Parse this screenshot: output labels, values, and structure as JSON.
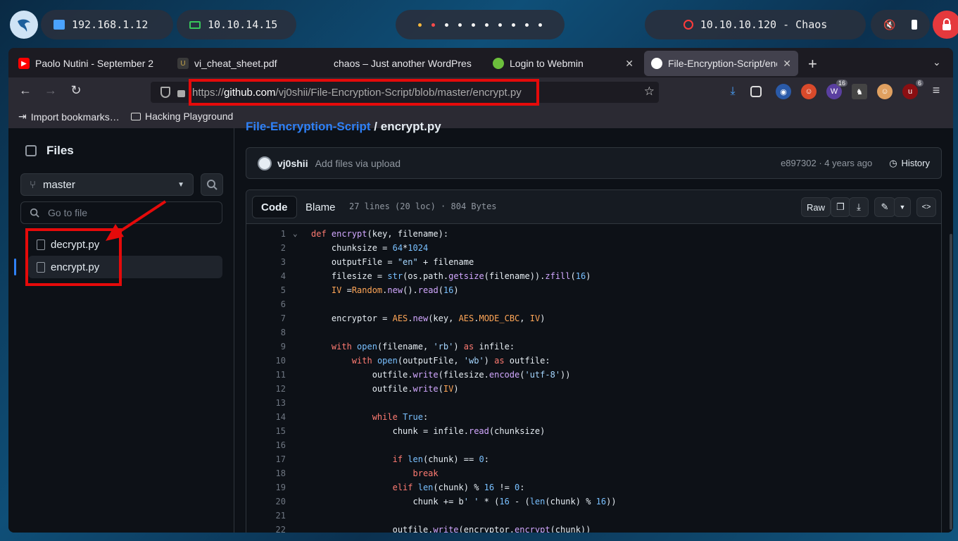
{
  "panel": {
    "ip_local": "192.168.1.12",
    "ip_vpn": "10.10.14.15",
    "target": "10.10.10.120 - Chaos",
    "workspace_dots": 10
  },
  "tabs": [
    {
      "title": "Paolo Nutini - September 2",
      "favicon": "youtube-icon",
      "color": "#ff0000",
      "active": false
    },
    {
      "title": "vi_cheat_sheet.pdf",
      "favicon": "pdf-icon",
      "color": "#c4a34a",
      "active": false
    },
    {
      "title": "chaos – Just another WordPres",
      "favicon": "none",
      "color": "",
      "active": false
    },
    {
      "title": "Login to Webmin",
      "favicon": "webmin-icon",
      "color": "#6cbf3c",
      "active": false
    },
    {
      "title": "File-Encryption-Script/encr",
      "favicon": "github-icon",
      "color": "#ffffff",
      "active": true
    }
  ],
  "urlbar": {
    "prefix": "https://",
    "host": "github.com",
    "path": "/vj0shii/File-Encryption-Script/blob/master/encrypt.py"
  },
  "extensions": [
    {
      "name": "download-icon"
    },
    {
      "name": "puzzle-icon"
    },
    {
      "name": "foxyproxy-icon"
    },
    {
      "name": "santa-icon"
    },
    {
      "name": "wappalyzer-icon",
      "badge": "16"
    },
    {
      "name": "cookie-editor-icon"
    },
    {
      "name": "hackbar-icon"
    },
    {
      "name": "ublock-icon",
      "badge": "6"
    }
  ],
  "bookmarks": [
    {
      "label": "Import bookmarks…",
      "icon": "import-icon"
    },
    {
      "label": "Hacking Playground",
      "icon": "folder-icon"
    }
  ],
  "sidebar": {
    "title": "Files",
    "branch": "master",
    "goto_placeholder": "Go to file",
    "files": [
      "decrypt.py",
      "encrypt.py"
    ],
    "selected": "encrypt.py"
  },
  "main": {
    "breadcrumb_repo": "File-Encryption-Script",
    "breadcrumb_file": "encrypt.py",
    "commit": {
      "author": "vj0shii",
      "message": "Add files via upload",
      "sha": "e897302",
      "age": "4 years ago",
      "history_label": "History"
    },
    "code_header": {
      "tab_code": "Code",
      "tab_blame": "Blame",
      "stats": "27 lines (20 loc) · 804 Bytes",
      "raw_label": "Raw"
    }
  },
  "code_lines": [
    {
      "n": "1",
      "html": "<span class='k'>def</span> <span class='f'>encrypt</span>(key, filename):"
    },
    {
      "n": "2",
      "html": "    chunksize = <span class='n'>64</span>*<span class='n'>1024</span>"
    },
    {
      "n": "3",
      "html": "    outputFile = <span class='s'>\"en\"</span> + filename"
    },
    {
      "n": "4",
      "html": "    filesize = <span class='n'>str</span>(os.path.<span class='f'>getsize</span>(filename)).<span class='f'>zfill</span>(<span class='n'>16</span>)"
    },
    {
      "n": "5",
      "html": "    <span class='c'>IV</span> =<span class='c'>Random</span>.<span class='f'>new</span>().<span class='f'>read</span>(<span class='n'>16</span>)"
    },
    {
      "n": "6",
      "html": ""
    },
    {
      "n": "7",
      "html": "    encryptor = <span class='c'>AES</span>.<span class='f'>new</span>(key, <span class='c'>AES</span>.<span class='c'>MODE_CBC</span>, <span class='c'>IV</span>)"
    },
    {
      "n": "8",
      "html": ""
    },
    {
      "n": "9",
      "html": "    <span class='k'>with</span> <span class='n'>open</span>(filename, <span class='s'>'rb'</span>) <span class='k'>as</span> infile:"
    },
    {
      "n": "10",
      "html": "        <span class='k'>with</span> <span class='n'>open</span>(outputFile, <span class='s'>'wb'</span>) <span class='k'>as</span> outfile:"
    },
    {
      "n": "11",
      "html": "            outfile.<span class='f'>write</span>(filesize.<span class='f'>encode</span>(<span class='s'>'utf-8'</span>))"
    },
    {
      "n": "12",
      "html": "            outfile.<span class='f'>write</span>(<span class='c'>IV</span>)"
    },
    {
      "n": "13",
      "html": ""
    },
    {
      "n": "14",
      "html": "            <span class='k'>while</span> <span class='n'>True</span>:"
    },
    {
      "n": "15",
      "html": "                chunk = infile.<span class='f'>read</span>(chunksize)"
    },
    {
      "n": "16",
      "html": ""
    },
    {
      "n": "17",
      "html": "                <span class='k'>if</span> <span class='n'>len</span>(chunk) == <span class='n'>0</span>:"
    },
    {
      "n": "18",
      "html": "                    <span class='k'>break</span>"
    },
    {
      "n": "19",
      "html": "                <span class='k'>elif</span> <span class='n'>len</span>(chunk) % <span class='n'>16</span> != <span class='n'>0</span>:"
    },
    {
      "n": "20",
      "html": "                    chunk += b<span class='s'>' '</span> * (<span class='n'>16</span> - (<span class='n'>len</span>(chunk) % <span class='n'>16</span>))"
    },
    {
      "n": "21",
      "html": ""
    },
    {
      "n": "22",
      "html": "                outfile.<span class='f'>write</span>(encryptor.<span class='f'>encrypt</span>(chunk))"
    }
  ]
}
